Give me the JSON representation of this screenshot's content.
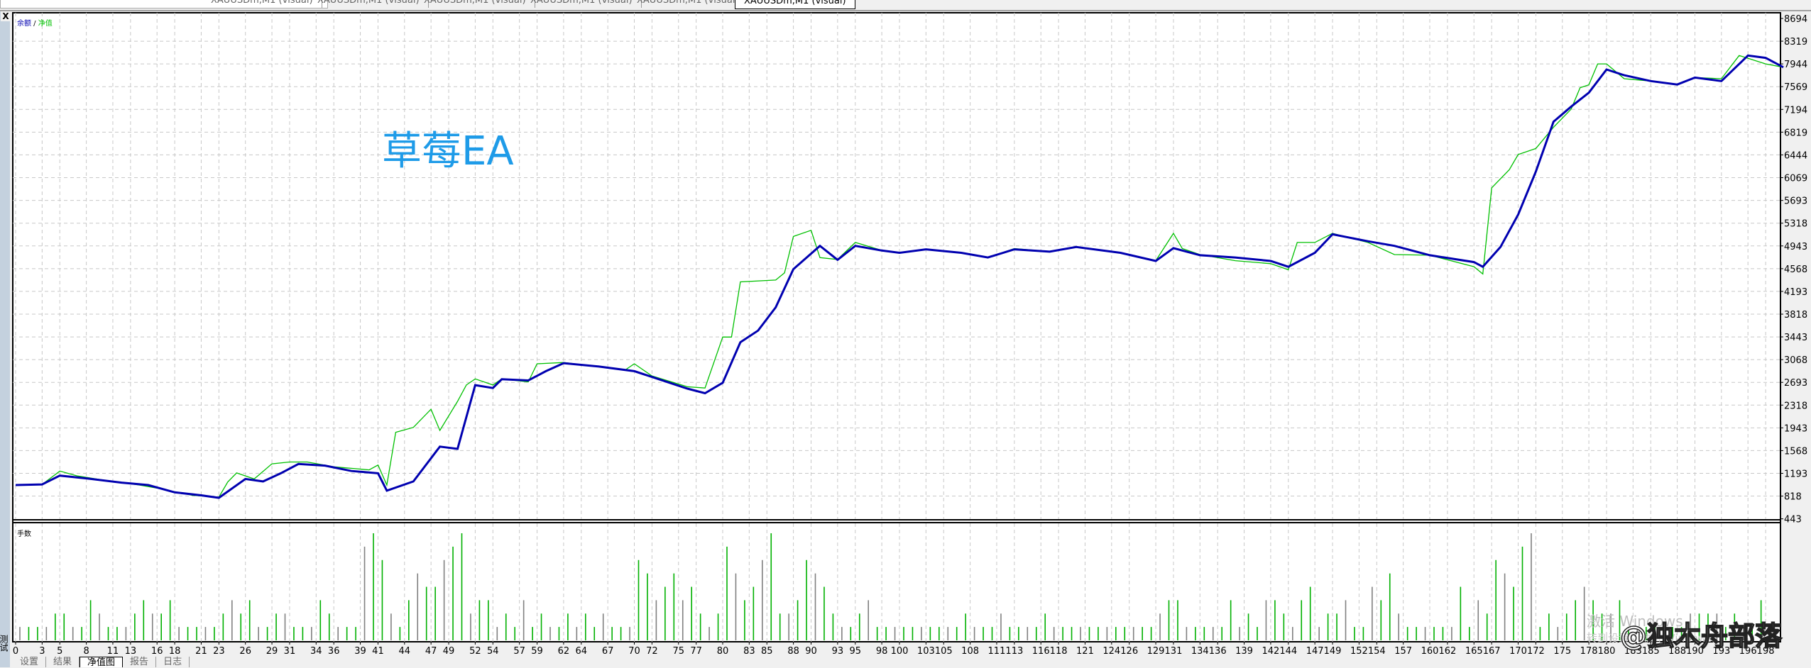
{
  "window_tabs": [
    "XAUUSDm,M1 (visual)",
    "XAUUSDm,M1 (visual)",
    "XAUUSDm,M1 (visual)",
    "XAUUSDm,M1 (visual)",
    "XAUUSDm,M1 (visual)",
    "XAUUSDm,M1 (visual)"
  ],
  "panel": {
    "close": "X",
    "side_label": "测试"
  },
  "overlay_title": "草莓EA",
  "bottom_tabs": [
    {
      "label": "设置",
      "active": false
    },
    {
      "label": "结果",
      "active": false
    },
    {
      "label": "净值图",
      "active": true
    },
    {
      "label": "报告",
      "active": false
    },
    {
      "label": "日志",
      "active": false
    }
  ],
  "watermark": {
    "activate_line1": "激活 Windows",
    "activate_line2": "转到设置以激活 Windows。",
    "brand": "@独木舟部落"
  },
  "colors": {
    "balance": "#0000b0",
    "equity": "#00c000",
    "title": "#1e9be8",
    "lots_a": "#00b000",
    "lots_b": "#808080"
  },
  "chart_data": [
    {
      "type": "line",
      "legend": {
        "balance": "余额",
        "separator": " / ",
        "equity": "净值"
      },
      "legend_placement": "top-left",
      "xlabel": "",
      "ylabel": "",
      "ylim": [
        443,
        8694
      ],
      "y_ticks": [
        8694,
        8319,
        7944,
        7569,
        7194,
        6819,
        6444,
        6069,
        5693,
        5318,
        4943,
        4568,
        4193,
        3818,
        3443,
        3068,
        2693,
        2318,
        1943,
        1568,
        1193,
        818,
        443
      ],
      "grid": true,
      "series": [
        {
          "name": "余额",
          "points": [
            [
              0,
              1000
            ],
            [
              3,
              1010
            ],
            [
              5,
              1155
            ],
            [
              8,
              1110
            ],
            [
              12,
              1040
            ],
            [
              15,
              1000
            ],
            [
              18,
              880
            ],
            [
              21,
              830
            ],
            [
              23,
              790
            ],
            [
              26,
              1100
            ],
            [
              28,
              1060
            ],
            [
              30,
              1194
            ],
            [
              32,
              1347
            ],
            [
              35,
              1320
            ],
            [
              38,
              1232
            ],
            [
              41,
              1194
            ],
            [
              42,
              907
            ],
            [
              45,
              1060
            ],
            [
              48,
              1634
            ],
            [
              50,
              1596
            ],
            [
              52,
              2648
            ],
            [
              54,
              2600
            ],
            [
              55,
              2744
            ],
            [
              58,
              2725
            ],
            [
              60,
              2878
            ],
            [
              62,
              3010
            ],
            [
              66,
              2954
            ],
            [
              70,
              2878
            ],
            [
              72,
              2782
            ],
            [
              76,
              2590
            ],
            [
              78,
              2514
            ],
            [
              80,
              2686
            ],
            [
              82,
              3355
            ],
            [
              84,
              3547
            ],
            [
              86,
              3930
            ],
            [
              88,
              4561
            ],
            [
              91,
              4944
            ],
            [
              93,
              4714
            ],
            [
              95,
              4944
            ],
            [
              98,
              4867
            ],
            [
              100,
              4829
            ],
            [
              103,
              4887
            ],
            [
              107,
              4829
            ],
            [
              110,
              4752
            ],
            [
              113,
              4887
            ],
            [
              117,
              4848
            ],
            [
              120,
              4925
            ],
            [
              125,
              4829
            ],
            [
              129,
              4695
            ],
            [
              131,
              4906
            ],
            [
              134,
              4790
            ],
            [
              138,
              4752
            ],
            [
              142,
              4695
            ],
            [
              144,
              4599
            ],
            [
              147,
              4829
            ],
            [
              149,
              5135
            ],
            [
              153,
              5020
            ],
            [
              156,
              4944
            ],
            [
              160,
              4790
            ],
            [
              165,
              4676
            ],
            [
              166,
              4599
            ],
            [
              168,
              4925
            ],
            [
              170,
              5460
            ],
            [
              172,
              6168
            ],
            [
              174,
              6991
            ],
            [
              176,
              7240
            ],
            [
              178,
              7470
            ],
            [
              180,
              7852
            ],
            [
              182,
              7757
            ],
            [
              185,
              7661
            ],
            [
              188,
              7604
            ],
            [
              190,
              7719
            ],
            [
              193,
              7661
            ],
            [
              196,
              8082
            ],
            [
              198,
              8044
            ],
            [
              200,
              7890
            ]
          ]
        },
        {
          "name": "净值",
          "points": [
            [
              0,
              1000
            ],
            [
              3,
              1010
            ],
            [
              5,
              1230
            ],
            [
              7,
              1150
            ],
            [
              10,
              1080
            ],
            [
              14,
              1000
            ],
            [
              16,
              950
            ],
            [
              20,
              830
            ],
            [
              23,
              800
            ],
            [
              24,
              1050
            ],
            [
              25,
              1200
            ],
            [
              27,
              1100
            ],
            [
              29,
              1350
            ],
            [
              31,
              1380
            ],
            [
              33,
              1380
            ],
            [
              36,
              1300
            ],
            [
              40,
              1250
            ],
            [
              41,
              1330
            ],
            [
              42,
              1000
            ],
            [
              43,
              1870
            ],
            [
              45,
              1950
            ],
            [
              47,
              2250
            ],
            [
              48,
              1900
            ],
            [
              50,
              2380
            ],
            [
              51,
              2650
            ],
            [
              52,
              2750
            ],
            [
              54,
              2650
            ],
            [
              55,
              2750
            ],
            [
              58,
              2700
            ],
            [
              59,
              3000
            ],
            [
              62,
              3020
            ],
            [
              66,
              2950
            ],
            [
              69,
              2900
            ],
            [
              70,
              3000
            ],
            [
              72,
              2800
            ],
            [
              76,
              2620
            ],
            [
              78,
              2600
            ],
            [
              80,
              3440
            ],
            [
              81,
              3440
            ],
            [
              82,
              4350
            ],
            [
              86,
              4380
            ],
            [
              87,
              4500
            ],
            [
              88,
              5100
            ],
            [
              90,
              5200
            ],
            [
              91,
              4750
            ],
            [
              93,
              4720
            ],
            [
              95,
              5000
            ],
            [
              98,
              4870
            ],
            [
              100,
              4830
            ],
            [
              103,
              4880
            ],
            [
              107,
              4830
            ],
            [
              110,
              4750
            ],
            [
              113,
              4900
            ],
            [
              117,
              4850
            ],
            [
              120,
              4930
            ],
            [
              125,
              4830
            ],
            [
              129,
              4700
            ],
            [
              131,
              5150
            ],
            [
              132,
              4900
            ],
            [
              134,
              4800
            ],
            [
              138,
              4700
            ],
            [
              142,
              4650
            ],
            [
              144,
              4550
            ],
            [
              145,
              5000
            ],
            [
              147,
              5000
            ],
            [
              149,
              5150
            ],
            [
              153,
              5000
            ],
            [
              156,
              4800
            ],
            [
              160,
              4790
            ],
            [
              165,
              4600
            ],
            [
              166,
              4480
            ],
            [
              167,
              5900
            ],
            [
              169,
              6200
            ],
            [
              170,
              6450
            ],
            [
              172,
              6550
            ],
            [
              174,
              6900
            ],
            [
              176,
              7200
            ],
            [
              177,
              7550
            ],
            [
              178,
              7600
            ],
            [
              179,
              7944
            ],
            [
              180,
              7944
            ],
            [
              182,
              7700
            ],
            [
              185,
              7661
            ],
            [
              188,
              7604
            ],
            [
              190,
              7719
            ],
            [
              193,
              7700
            ],
            [
              195,
              8082
            ],
            [
              198,
              7944
            ],
            [
              200,
              7890
            ]
          ]
        }
      ],
      "x_ticks": [
        0,
        3,
        5,
        8,
        11,
        13,
        16,
        18,
        21,
        23,
        26,
        29,
        31,
        34,
        36,
        39,
        41,
        44,
        47,
        49,
        52,
        54,
        57,
        59,
        62,
        64,
        67,
        70,
        72,
        75,
        77,
        80,
        83,
        85,
        88,
        90,
        93,
        95,
        98,
        100,
        103,
        105,
        108,
        111,
        113,
        116,
        118,
        121,
        124,
        126,
        129,
        131,
        134,
        136,
        139,
        142,
        144,
        147,
        149,
        152,
        154,
        157,
        160,
        162,
        165,
        167,
        170,
        172,
        175,
        178,
        180,
        183,
        185,
        188,
        190,
        193,
        196,
        198
      ]
    },
    {
      "type": "bar",
      "title": "手数",
      "ylim": [
        0,
        8
      ],
      "values": [
        1,
        1,
        1,
        1,
        2,
        2,
        1,
        1,
        3,
        2,
        1,
        1,
        1,
        2,
        3,
        2,
        2,
        3,
        1,
        1,
        1,
        1,
        1,
        2,
        3,
        2,
        3,
        1,
        1,
        2,
        2,
        1,
        1,
        1,
        3,
        2,
        1,
        1,
        1,
        7,
        8,
        6,
        2,
        1,
        3,
        5,
        4,
        4,
        6,
        7,
        8,
        2,
        3,
        3,
        1,
        2,
        1,
        3,
        1,
        2,
        1,
        1,
        2,
        1,
        2,
        1,
        2,
        1,
        1,
        1,
        6,
        5,
        3,
        4,
        5,
        3,
        4,
        2,
        1,
        2,
        7,
        5,
        3,
        4,
        6,
        8,
        2,
        2,
        3,
        6,
        5,
        4,
        2,
        1,
        1,
        2,
        3,
        1,
        1,
        1,
        1,
        1,
        1,
        1,
        1,
        1,
        1,
        2,
        1,
        1,
        1,
        2,
        1,
        1,
        1,
        1,
        2,
        1,
        1,
        1,
        1,
        1,
        1,
        1,
        1,
        1,
        1,
        1,
        1,
        2,
        3,
        3,
        1,
        1,
        1,
        1,
        1,
        3,
        1,
        2,
        1,
        3,
        3,
        2,
        1,
        3,
        4,
        1,
        2,
        2,
        3,
        1,
        1,
        4,
        3,
        5,
        2,
        1,
        1,
        1,
        1,
        1,
        1,
        4,
        1,
        3,
        2,
        6,
        5,
        4,
        7,
        8,
        1,
        2,
        1,
        2,
        3,
        4,
        3,
        2,
        2,
        3,
        1,
        1,
        1,
        1,
        1,
        1,
        1,
        2,
        2,
        2,
        2,
        1,
        2,
        1,
        1,
        3
      ]
    }
  ]
}
